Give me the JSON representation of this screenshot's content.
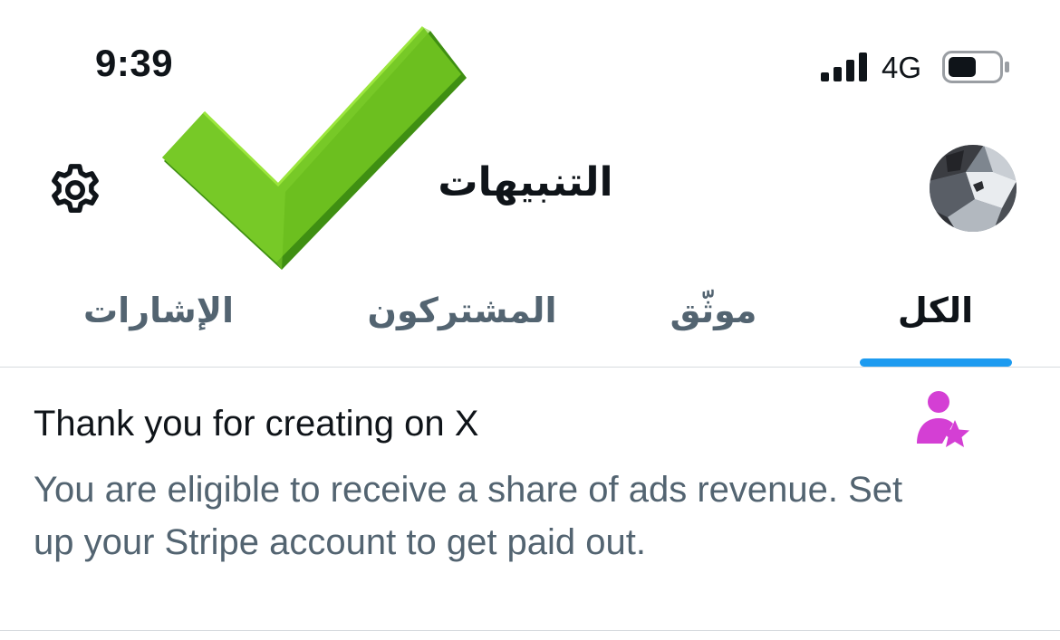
{
  "status_bar": {
    "time": "9:39",
    "network": "4G",
    "icons": [
      "cellular-signal-icon",
      "battery-icon"
    ]
  },
  "header": {
    "title": "التنبيهات",
    "icons": [
      "avatar",
      "gear-icon",
      "green-checkmark-icon"
    ]
  },
  "tabs": [
    {
      "label": "الكل",
      "active": true
    },
    {
      "label": "موثّق",
      "active": false
    },
    {
      "label": "المشتركون",
      "active": false
    },
    {
      "label": "الإشارات",
      "active": false
    }
  ],
  "notification": {
    "icon": "person-star-icon",
    "title": "Thank you for creating on X",
    "body": "You are eligible to receive a share of ads revenue. Set up your Stripe account to get paid out."
  },
  "colors": {
    "accent": "#1d9bf0",
    "text_primary": "#0f1419",
    "text_secondary": "#536471",
    "divider": "#d7dbdf",
    "notif_icon": "#d43fd4",
    "checkmark": "#6cbf1f"
  }
}
